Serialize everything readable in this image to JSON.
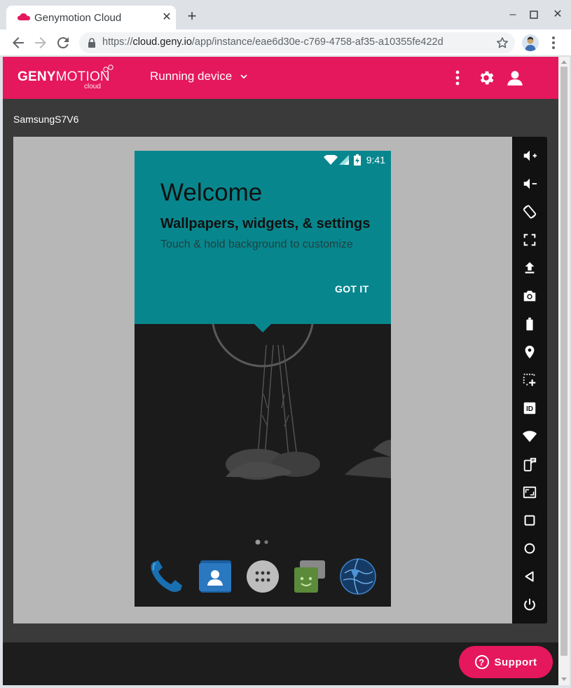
{
  "browser": {
    "tab_title": "Genymotion Cloud",
    "url_scheme": "https://",
    "url_host": "cloud.geny.io",
    "url_path": "/app/instance/eae6d30e-c769-4758-af35-a10355fe422d"
  },
  "app": {
    "brand_bold": "GENY",
    "brand_light": "MOTION",
    "brand_sub": "cloud",
    "device_menu_label": "Running device",
    "device_name": "SamsungS7V6",
    "support_label": "Support",
    "support_glyph": "?"
  },
  "android": {
    "status_time": "9:41",
    "welcome_title": "Welcome",
    "welcome_subtitle": "Wallpapers, widgets, & settings",
    "welcome_hint": "Touch & hold background to customize",
    "got_it_label": "GOT IT"
  },
  "sidebar_icons": [
    "volume-up-icon",
    "volume-down-icon",
    "rotate-icon",
    "fullscreen-icon",
    "upload-icon",
    "camera-icon",
    "battery-icon",
    "location-icon",
    "multitouch-icon",
    "device-id-icon",
    "wifi-icon",
    "phone-sms-icon",
    "resize-icon",
    "recent-apps-icon",
    "home-icon",
    "back-icon",
    "power-icon"
  ],
  "sidebar_id_glyph": "ID",
  "colors": {
    "brand_pink": "#e5175d",
    "android_teal": "#07878d",
    "viewport_bg": "#3a3a3a",
    "player_bg": "#b7b7b7"
  }
}
